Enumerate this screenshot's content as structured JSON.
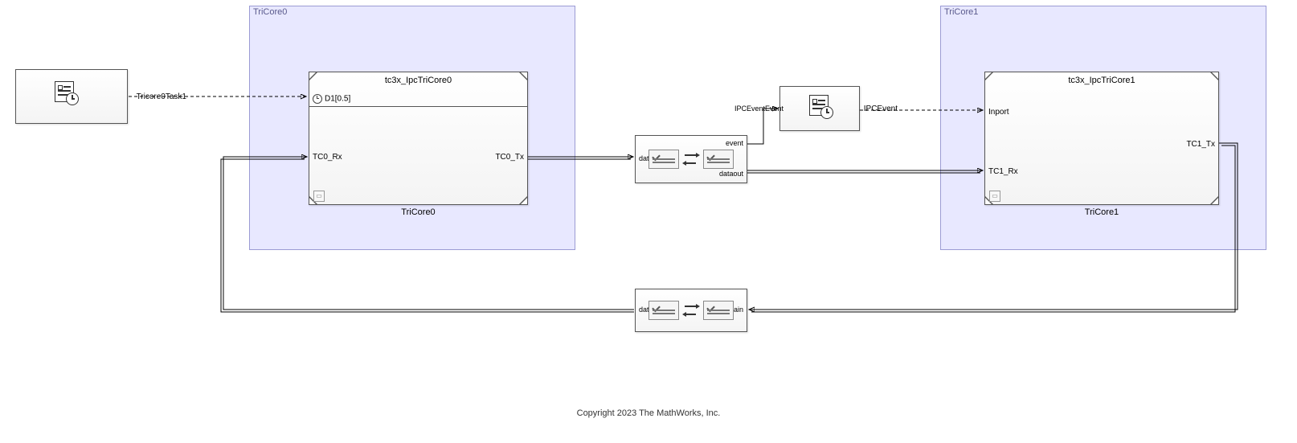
{
  "areas": {
    "tricore0": {
      "label": "TriCore0"
    },
    "tricore1": {
      "label": "TriCore1"
    }
  },
  "task": {
    "label": "Tricore0Task1"
  },
  "tricore0_block": {
    "title": "tc3x_IpcTriCore0",
    "name": "TriCore0",
    "port_trigger": "D1[0.5]",
    "port_in": "TC0_Rx",
    "port_out": "TC0_Tx"
  },
  "ipc_fwd": {
    "port_in": "datain",
    "port_out_top": "event",
    "port_out_bot": "dataout"
  },
  "ipc_event": {
    "port_in": "IPCEventEvent",
    "port_out": "IPCEvent"
  },
  "tricore1_block": {
    "title": "tc3x_IpcTriCore1",
    "name": "TriCore1",
    "port_in_top": "Inport",
    "port_in_bot": "TC1_Rx",
    "port_out": "TC1_Tx"
  },
  "ipc_back": {
    "port_in": "datain",
    "port_out": "dataout"
  },
  "footer": "Copyright 2023 The MathWorks, Inc."
}
